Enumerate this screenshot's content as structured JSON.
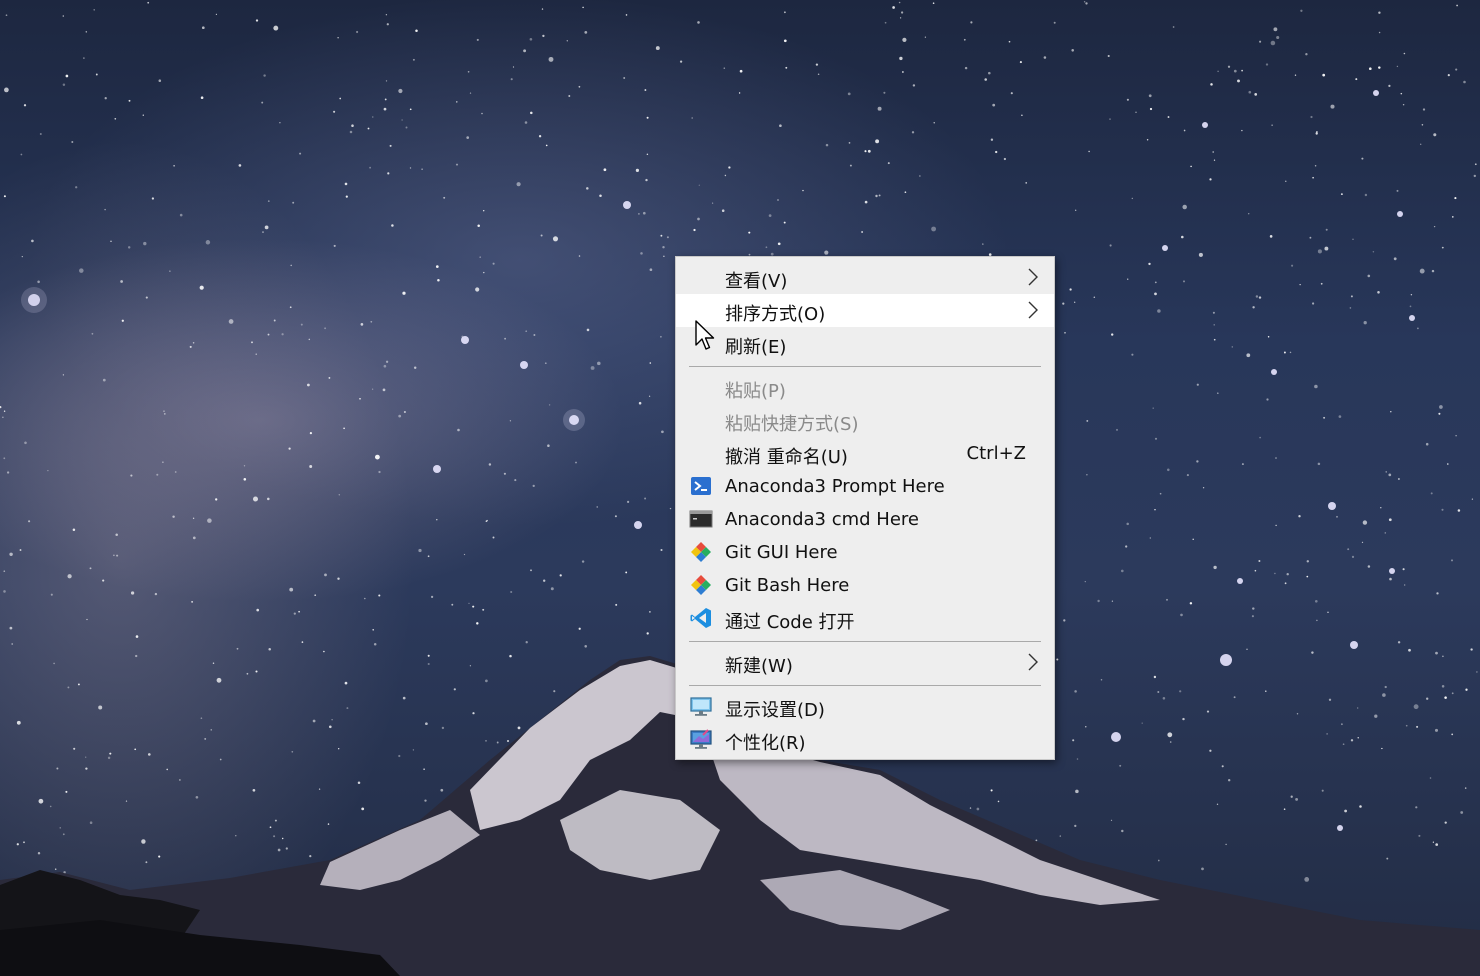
{
  "context_menu": {
    "view": {
      "label": "查看(V)"
    },
    "sort_by": {
      "label": "排序方式(O)"
    },
    "refresh": {
      "label": "刷新(E)"
    },
    "paste": {
      "label": "粘贴(P)"
    },
    "paste_shortcut": {
      "label": "粘贴快捷方式(S)"
    },
    "undo_rename": {
      "label": "撤消 重命名(U)",
      "shortcut": "Ctrl+Z"
    },
    "anaconda_prompt": {
      "label": "Anaconda3 Prompt Here",
      "icon": "powershell-icon"
    },
    "anaconda_cmd": {
      "label": "Anaconda3 cmd Here",
      "icon": "cmd-icon"
    },
    "git_gui": {
      "label": "Git GUI Here",
      "icon": "git-gui-icon"
    },
    "git_bash": {
      "label": "Git Bash Here",
      "icon": "git-bash-icon"
    },
    "open_with_code": {
      "label": "通过 Code 打开",
      "icon": "vscode-icon"
    },
    "new": {
      "label": "新建(W)"
    },
    "display_settings": {
      "label": "显示设置(D)",
      "icon": "display-settings-icon"
    },
    "personalize": {
      "label": "个性化(R)",
      "icon": "personalize-icon"
    }
  },
  "colors": {
    "menu_background": "#eeeeee",
    "menu_hover": "#ffffff",
    "disabled_text": "#8a8a8a",
    "separator": "#a9a9a9"
  }
}
